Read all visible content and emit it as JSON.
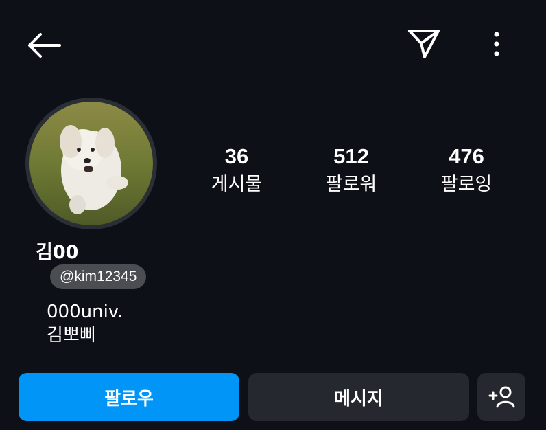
{
  "header": {
    "back_icon": "arrow-left-icon",
    "send_icon": "paper-plane-icon",
    "more_icon": "more-vertical-icon"
  },
  "profile": {
    "name": "김00",
    "handle": "@kim12345",
    "bio_line1": "000univ.",
    "bio_line2": "김뽀삐"
  },
  "stats": [
    {
      "value": "36",
      "label": "게시물"
    },
    {
      "value": "512",
      "label": "팔로워"
    },
    {
      "value": "476",
      "label": "팔로잉"
    }
  ],
  "actions": {
    "follow_label": "팔로우",
    "message_label": "메시지",
    "add_user_icon": "add-person-icon"
  },
  "colors": {
    "background": "#0d1017",
    "primary": "#0095f6",
    "secondary_button": "#25282e",
    "handle_pill": "#4a4d52"
  }
}
